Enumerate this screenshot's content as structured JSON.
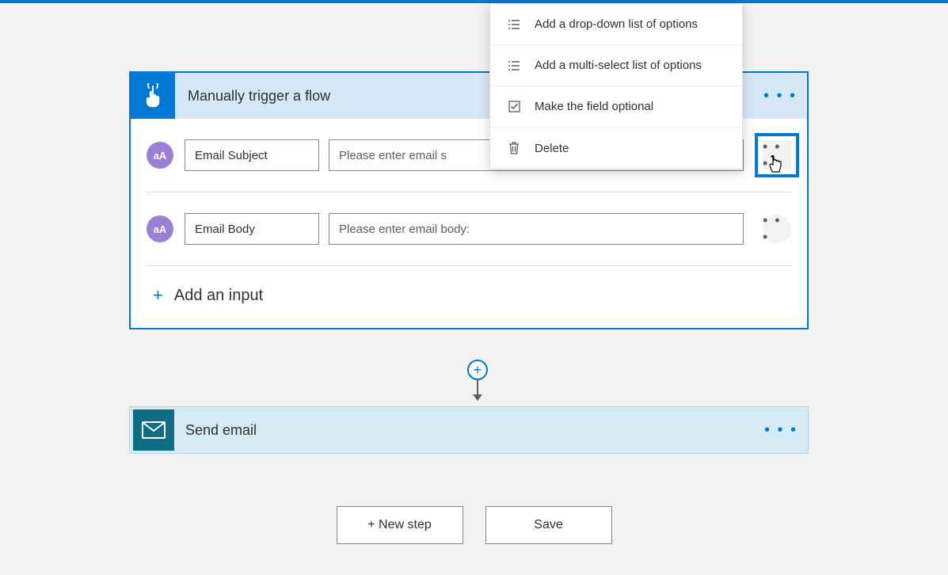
{
  "trigger": {
    "title": "Manually trigger a flow",
    "inputs": [
      {
        "name": "Email Subject",
        "placeholder": "Please enter email s",
        "icon_label": "aA"
      },
      {
        "name": "Email Body",
        "placeholder": "Please enter email body:",
        "icon_label": "aA"
      }
    ],
    "add_input_label": "Add an input"
  },
  "action": {
    "title": "Send email"
  },
  "buttons": {
    "new_step": "+ New step",
    "save": "Save"
  },
  "dropdown": {
    "items": [
      {
        "label": "Add a drop-down list of options"
      },
      {
        "label": "Add a multi-select list of options"
      },
      {
        "label": "Make the field optional"
      },
      {
        "label": "Delete"
      }
    ]
  },
  "ellipsis": "• • •",
  "plus": "+"
}
